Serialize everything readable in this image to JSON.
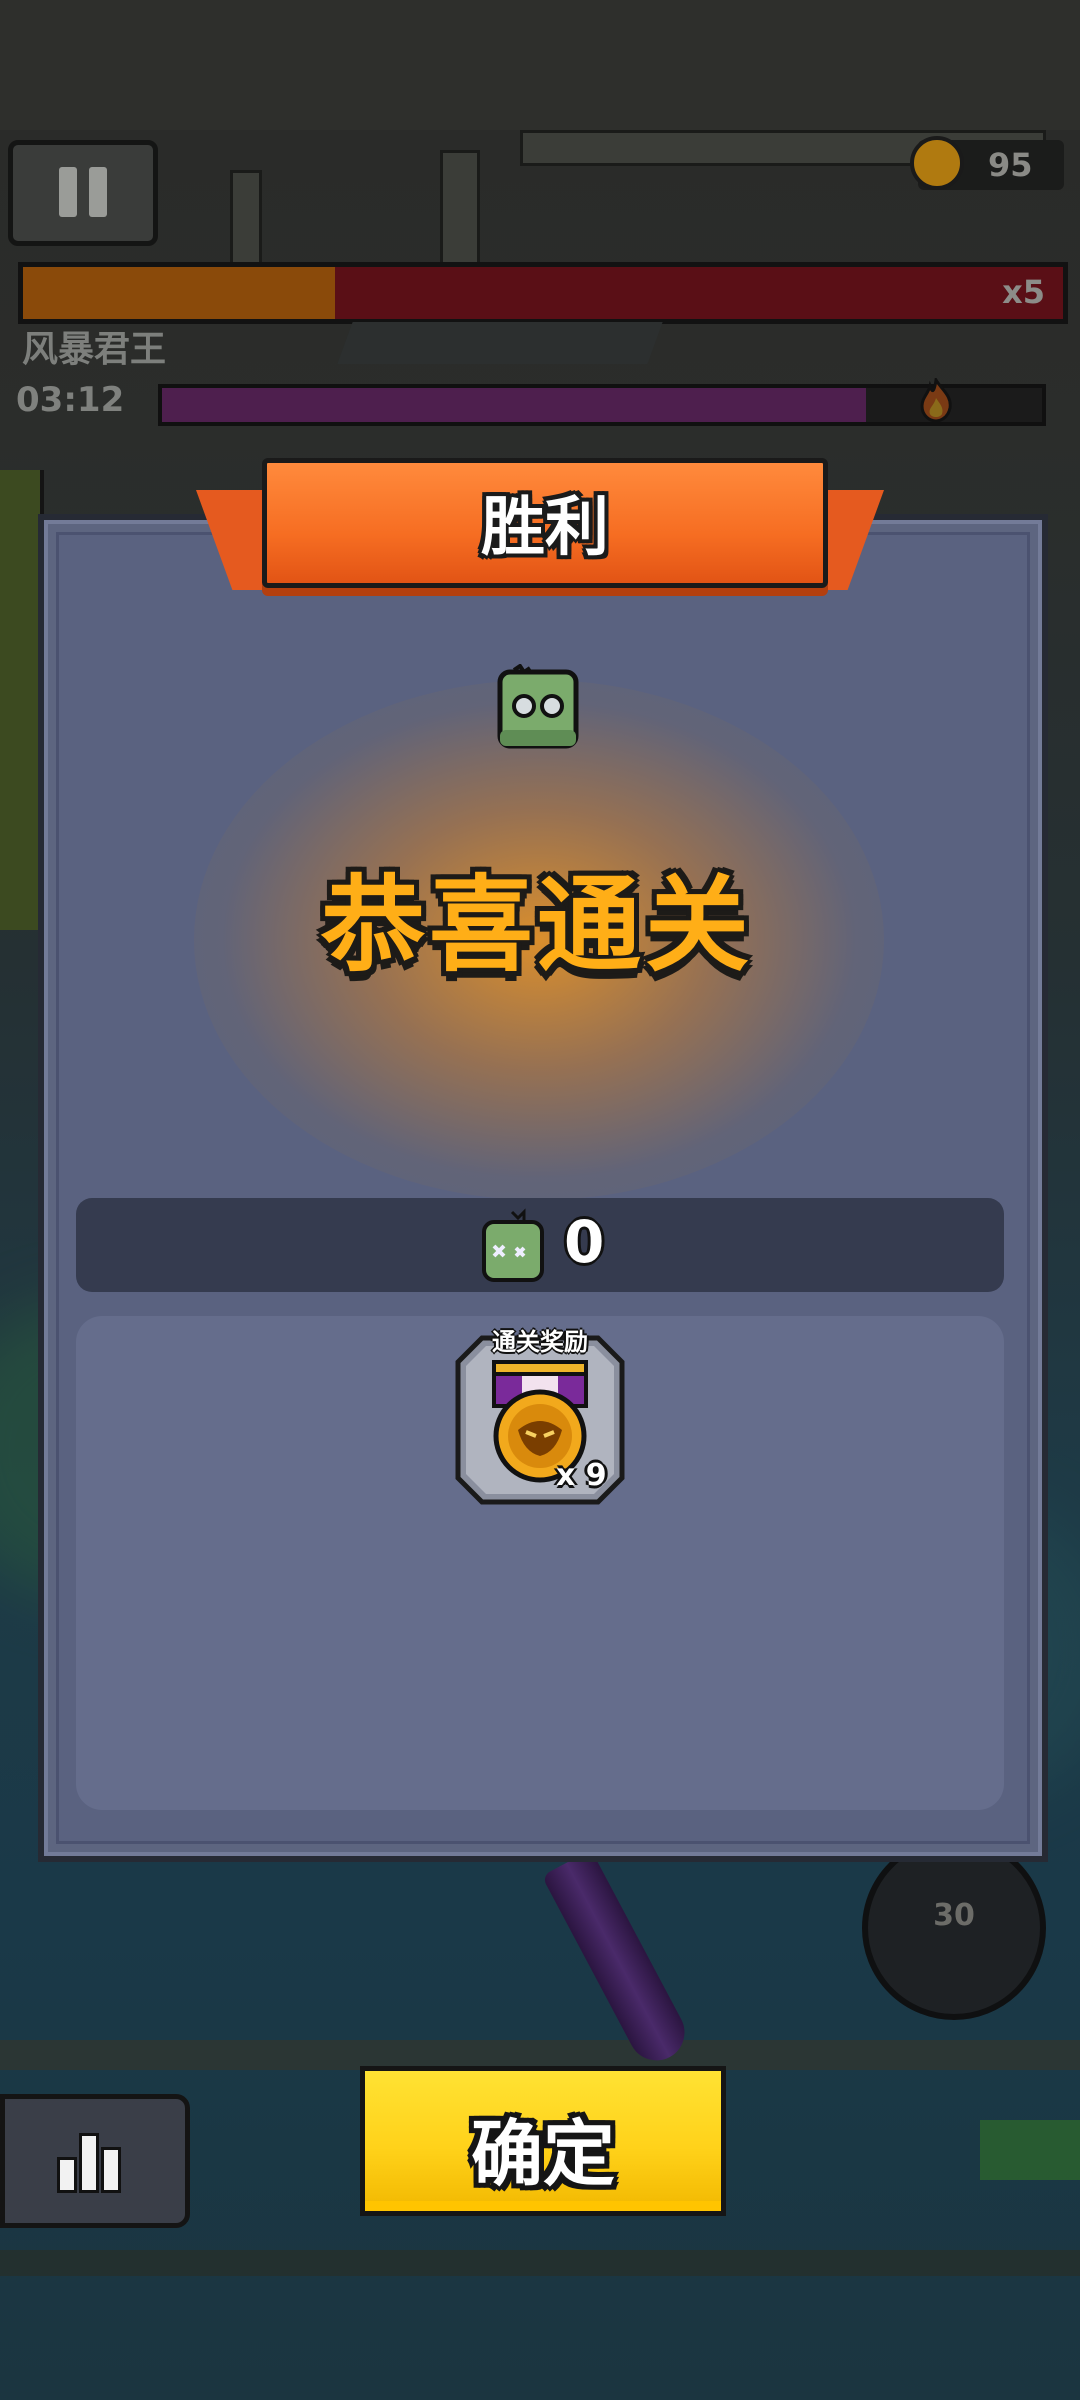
{
  "hud": {
    "medal_count": "95",
    "boss_hp_multiplier": "x5",
    "boss_hp_fraction": 0.3,
    "boss_name": "风暴君王",
    "timer": "03:12",
    "time_fraction": 0.8,
    "skill_cooldown": "30"
  },
  "panel": {
    "ribbon_title": "胜利",
    "congrats_text": "恭喜通关",
    "kills_value": "0",
    "reward_section": {
      "label": "通关奖励",
      "item_icon": "medal-icon",
      "quantity": "x 9"
    }
  },
  "confirm_label": "确定",
  "colors": {
    "ribbon": "#f66d22",
    "congrats_text": "#ffae17",
    "confirm_button": "#ffd21a",
    "panel": "#5d6580"
  }
}
